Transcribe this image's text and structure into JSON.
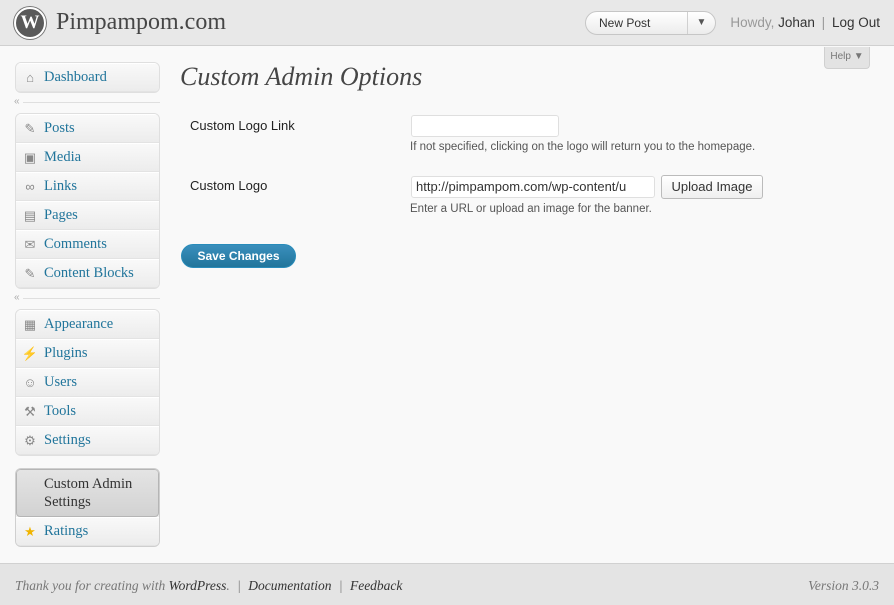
{
  "header": {
    "site_title": "Pimpampom.com",
    "logo_glyph": "W",
    "favorite": {
      "label": "New Post",
      "toggle_glyph": "▼"
    },
    "user": {
      "howdy": "Howdy,",
      "name": "Johan",
      "separator": "|",
      "logout": "Log Out"
    }
  },
  "help_tab": "Help ▼",
  "sidebar": {
    "dashboard": {
      "label": "Dashboard",
      "icon": "dashboard-icon",
      "glyph": "⌂"
    },
    "separator_glyph": "«",
    "content_items": [
      {
        "label": "Posts",
        "icon": "pin-icon",
        "glyph": "✎"
      },
      {
        "label": "Media",
        "icon": "media-icon",
        "glyph": "▣"
      },
      {
        "label": "Links",
        "icon": "link-icon",
        "glyph": "∞"
      },
      {
        "label": "Pages",
        "icon": "page-icon",
        "glyph": "▤"
      },
      {
        "label": "Comments",
        "icon": "comment-icon",
        "glyph": "✉"
      },
      {
        "label": "Content Blocks",
        "icon": "pin-icon",
        "glyph": "✎"
      }
    ],
    "admin_items": [
      {
        "label": "Appearance",
        "icon": "appearance-icon",
        "glyph": "▦"
      },
      {
        "label": "Plugins",
        "icon": "plug-icon",
        "glyph": "⚡"
      },
      {
        "label": "Users",
        "icon": "users-icon",
        "glyph": "☺"
      },
      {
        "label": "Tools",
        "icon": "tools-icon",
        "glyph": "⚒"
      },
      {
        "label": "Settings",
        "icon": "settings-icon",
        "glyph": "⚙"
      }
    ],
    "current_item": {
      "label": "Custom Admin Settings"
    },
    "ratings": {
      "label": "Ratings",
      "icon": "star-icon",
      "glyph": "★",
      "color": "#f0b400"
    }
  },
  "main": {
    "title": "Custom Admin Options",
    "logo_link": {
      "label": "Custom Logo Link",
      "value": "",
      "description": "If not specified, clicking on the logo will return you to the homepage."
    },
    "logo": {
      "label": "Custom Logo",
      "value": "http://pimpampom.com/wp-content/u",
      "upload_label": "Upload Image",
      "description": "Enter a URL or upload an image for the banner."
    },
    "save_label": "Save Changes"
  },
  "footer": {
    "thanks_prefix": "Thank you for creating with",
    "wordpress": "WordPress",
    "thanks_suffix": ".",
    "separator": "|",
    "documentation": "Documentation",
    "feedback": "Feedback",
    "version": "Version 3.0.3"
  },
  "colors": {
    "link": "#21759b",
    "primary_button": "#21759b",
    "header_bg": "#e8e8e8"
  }
}
